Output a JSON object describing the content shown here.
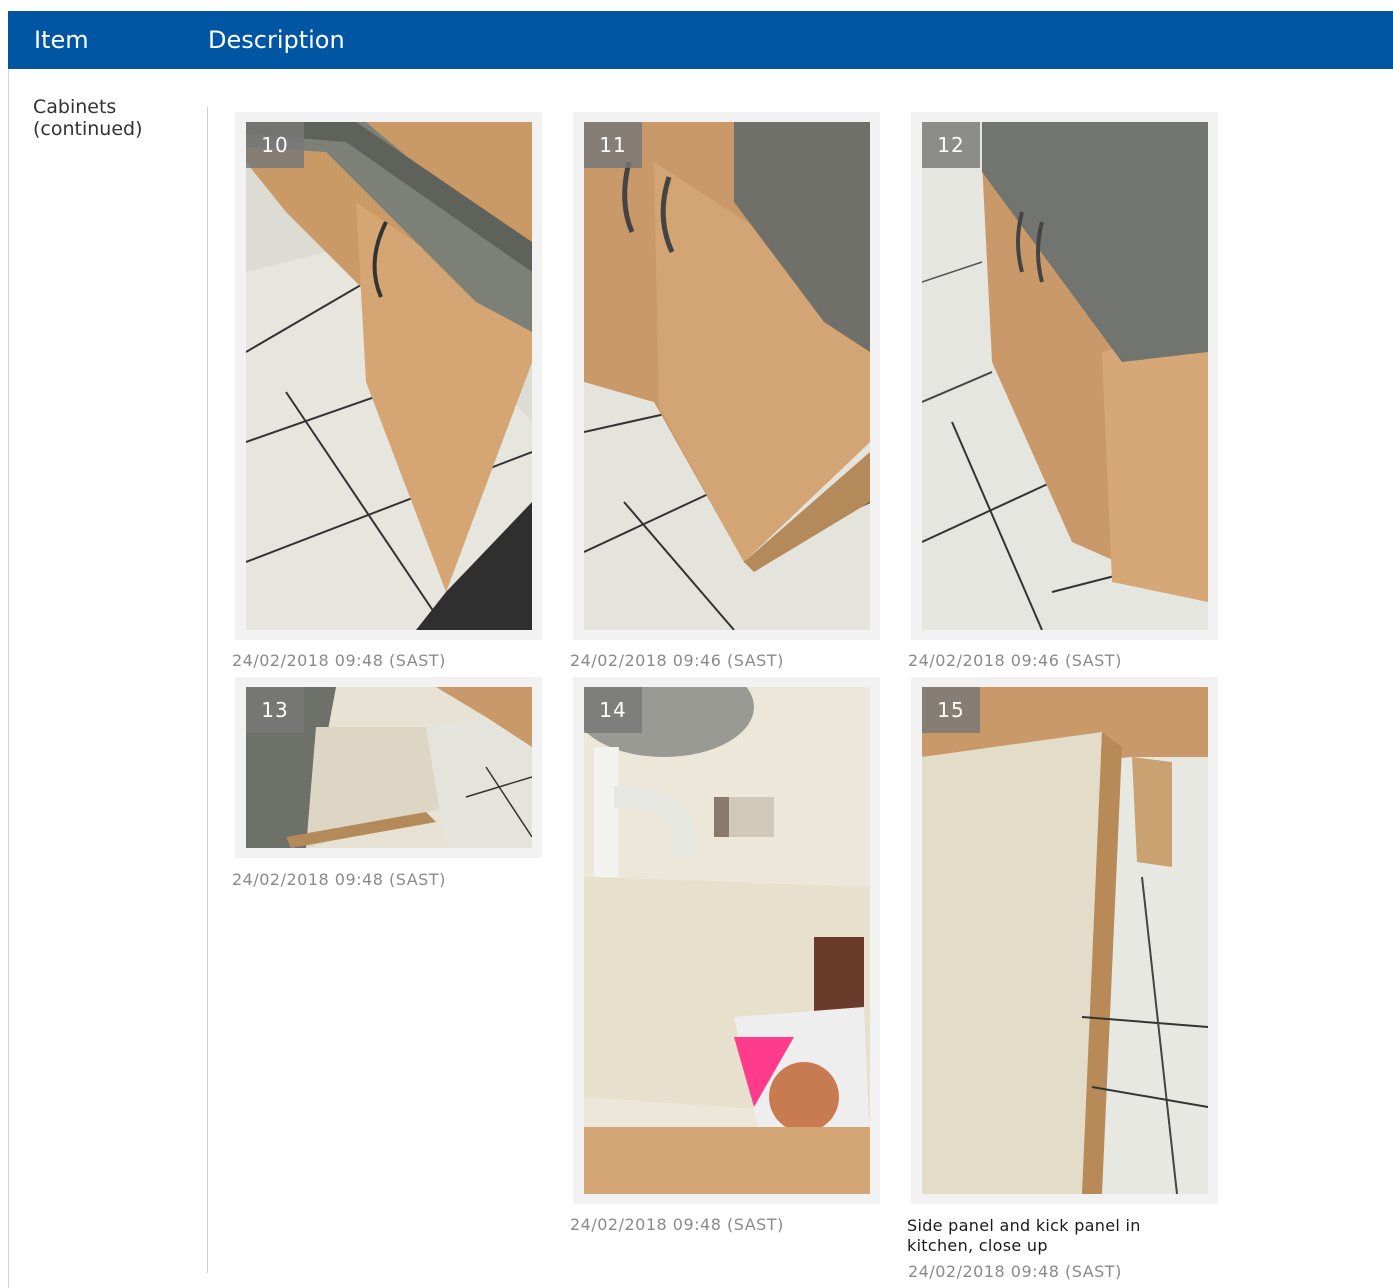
{
  "header": {
    "col_item": "Item",
    "col_description": "Description",
    "color": "#0056a3"
  },
  "item": {
    "label_line1": "Cabinets",
    "label_line2": "(continued)"
  },
  "photos": [
    {
      "number": "10",
      "timestamp": "24/02/2018 09:48 (SAST)",
      "caption": ""
    },
    {
      "number": "11",
      "timestamp": "24/02/2018 09:46 (SAST)",
      "caption": ""
    },
    {
      "number": "12",
      "timestamp": "24/02/2018 09:46 (SAST)",
      "caption": ""
    },
    {
      "number": "13",
      "timestamp": "24/02/2018 09:48 (SAST)",
      "caption": ""
    },
    {
      "number": "14",
      "timestamp": "24/02/2018 09:48 (SAST)",
      "caption": ""
    },
    {
      "number": "15",
      "timestamp": "24/02/2018 09:48 (SAST)",
      "caption_line1": "Side panel and kick panel in",
      "caption_line2": "kitchen, close up"
    }
  ]
}
